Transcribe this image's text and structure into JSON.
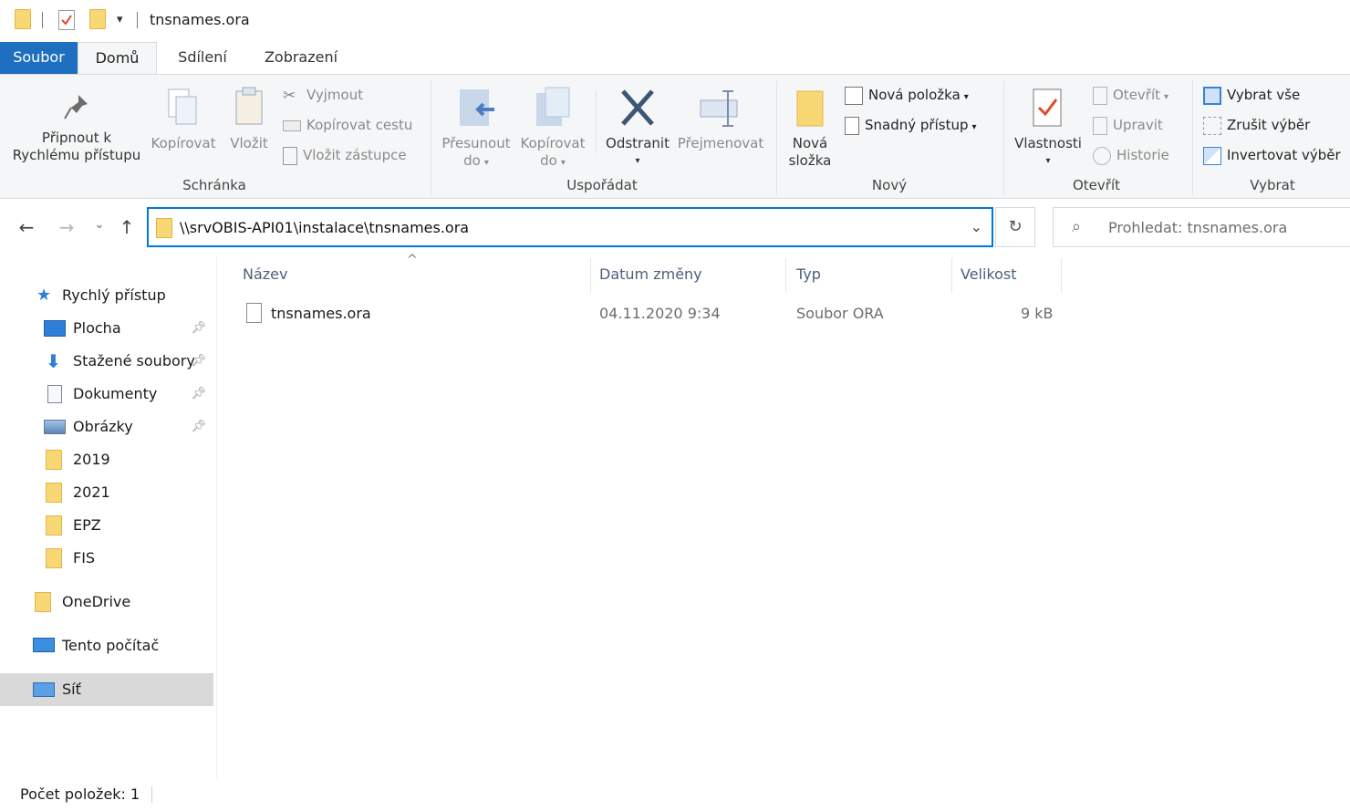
{
  "window": {
    "title": "tnsnames.ora"
  },
  "tabs": {
    "file": "Soubor",
    "home": "Domů",
    "share": "Sdílení",
    "view": "Zobrazení"
  },
  "ribbon": {
    "clipboard": {
      "label": "Schránka",
      "pin_line1": "Připnout k",
      "pin_line2": "Rychlému přístupu",
      "copy": "Kopírovat",
      "paste": "Vložit",
      "cut": "Vyjmout",
      "copy_path": "Kopírovat cestu",
      "paste_shortcut": "Vložit zástupce"
    },
    "organize": {
      "label": "Uspořádat",
      "move_line1": "Přesunout",
      "move_line2": "do",
      "copyto_line1": "Kopírovat",
      "copyto_line2": "do",
      "delete": "Odstranit",
      "rename": "Přejmenovat"
    },
    "new": {
      "label": "Nový",
      "new_folder_line1": "Nová",
      "new_folder_line2": "složka",
      "new_item": "Nová položka",
      "easy_access": "Snadný přístup"
    },
    "open": {
      "label": "Otevřít",
      "properties": "Vlastnosti",
      "open": "Otevřít",
      "edit": "Upravit",
      "history": "Historie"
    },
    "select": {
      "label": "Vybrat",
      "select_all": "Vybrat vše",
      "select_none": "Zrušit výběr",
      "invert": "Invertovat výběr"
    }
  },
  "address": {
    "path": "\\\\srvOBIS-API01\\instalace\\tnsnames.ora"
  },
  "search": {
    "placeholder": "Prohledat: tnsnames.ora"
  },
  "nav": {
    "quick_access": "Rychlý přístup",
    "items": [
      {
        "label": "Plocha",
        "pinned": true
      },
      {
        "label": "Stažené soubory",
        "pinned": true
      },
      {
        "label": "Dokumenty",
        "pinned": true
      },
      {
        "label": "Obrázky",
        "pinned": true
      },
      {
        "label": "2019",
        "pinned": false
      },
      {
        "label": "2021",
        "pinned": false
      },
      {
        "label": "EPZ",
        "pinned": false
      },
      {
        "label": "FIS",
        "pinned": false
      }
    ],
    "onedrive": "OneDrive",
    "this_pc": "Tento počítač",
    "network": "Síť"
  },
  "columns": {
    "name": "Název",
    "date": "Datum změny",
    "type": "Typ",
    "size": "Velikost"
  },
  "files": [
    {
      "name": "tnsnames.ora",
      "date": "04.11.2020 9:34",
      "type": "Soubor ORA",
      "size": "9 kB"
    }
  ],
  "status": {
    "count": "Počet položek: 1"
  }
}
